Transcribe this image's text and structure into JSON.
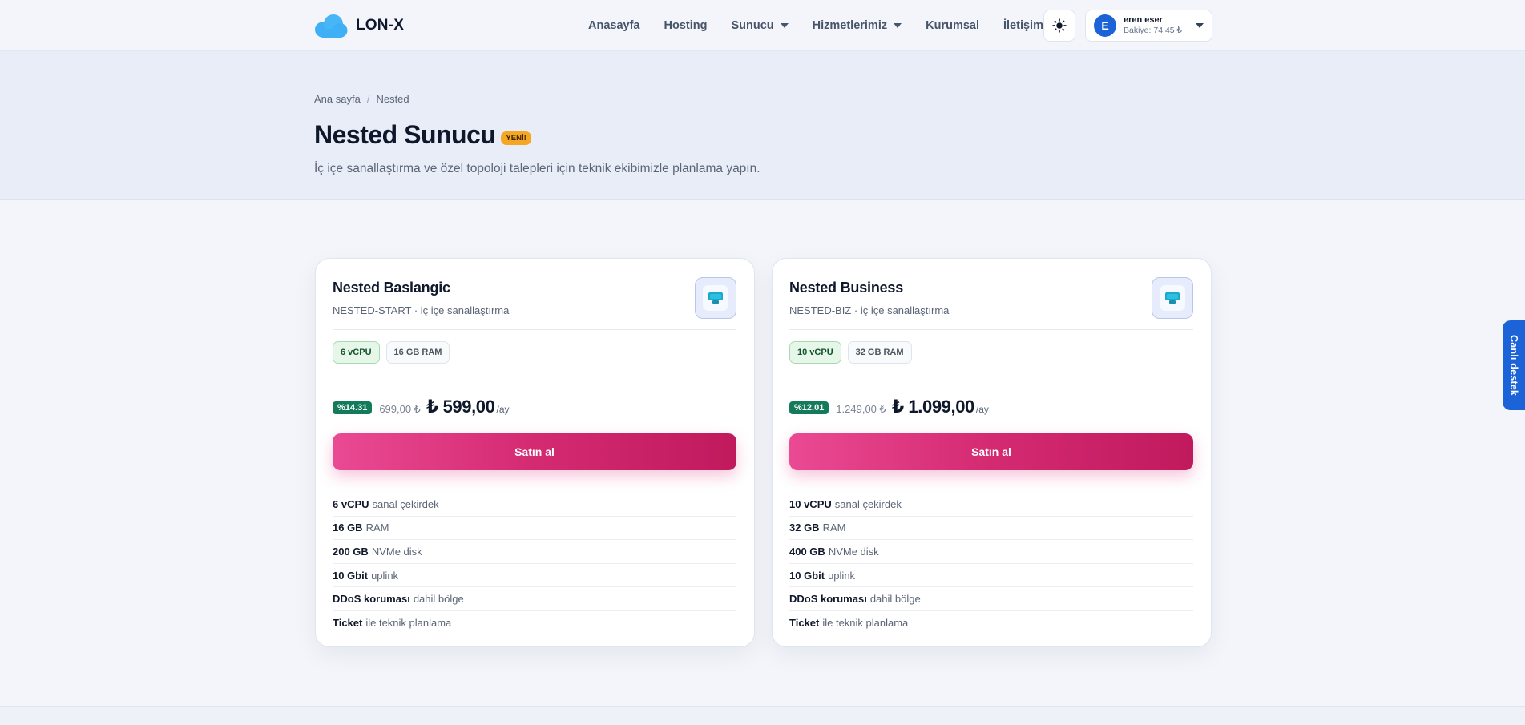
{
  "header": {
    "brand": "LON-X",
    "nav": [
      {
        "label": "Anasayfa"
      },
      {
        "label": "Hosting"
      },
      {
        "label": "Sunucu"
      },
      {
        "label": "Hizmetlerimiz"
      },
      {
        "label": "Kurumsal"
      },
      {
        "label": "İletişim"
      }
    ],
    "user": {
      "initial": "E",
      "name": "eren eser",
      "balance": "Bakiye: 74.45 ₺"
    }
  },
  "hero": {
    "breadcrumb": [
      "Ana sayfa",
      "Nested"
    ],
    "breadcrumb_sep": "/",
    "title": "Nested Sunucu",
    "badge": "YENİ!",
    "subtitle": "İç içe sanallaştırma ve özel topoloji talepleri için teknik ekibimizle planlama yapın."
  },
  "plans": [
    {
      "name": "Nested Baslangic",
      "subtitle": "NESTED-START · iç içe sanallaştırma",
      "tags": [
        "6 vCPU",
        "16 GB RAM"
      ],
      "discount": "%14.31",
      "old_price": "699,00 ₺",
      "price": "₺ 599,00",
      "period": "/ay",
      "button": "Satın al",
      "features": [
        {
          "strong": "6 vCPU",
          "text": "sanal çekirdek"
        },
        {
          "strong": "16 GB",
          "text": "RAM"
        },
        {
          "strong": "200 GB",
          "text": "NVMe disk"
        },
        {
          "strong": "10 Gbit",
          "text": "uplink"
        },
        {
          "strong": "DDoS koruması",
          "text": "dahil bölge"
        },
        {
          "strong": "Ticket",
          "text": "ile teknik planlama"
        }
      ]
    },
    {
      "name": "Nested Business",
      "subtitle": "NESTED-BIZ · iç içe sanallaştırma",
      "tags": [
        "10 vCPU",
        "32 GB RAM"
      ],
      "discount": "%12.01",
      "old_price": "1.249,00 ₺",
      "price": "₺ 1.099,00",
      "period": "/ay",
      "button": "Satın al",
      "features": [
        {
          "strong": "10 vCPU",
          "text": "sanal çekirdek"
        },
        {
          "strong": "32 GB",
          "text": "RAM"
        },
        {
          "strong": "400 GB",
          "text": "NVMe disk"
        },
        {
          "strong": "10 Gbit",
          "text": "uplink"
        },
        {
          "strong": "DDoS koruması",
          "text": "dahil bölge"
        },
        {
          "strong": "Ticket",
          "text": "ile teknik planlama"
        }
      ]
    }
  ],
  "live_support": "Canlı destek",
  "icons": {
    "brand": "cloud-icon",
    "theme": "sun-icon",
    "plan": "server-icon",
    "dropdown": "chevron-down-icon"
  },
  "colors": {
    "brand_cloud": "#3fb0f5",
    "accent_button": "#d42a72",
    "discount_badge": "#137a5a",
    "new_badge": "#f5a623",
    "support_tab": "#1d63d8",
    "avatar": "#1d63d8"
  }
}
